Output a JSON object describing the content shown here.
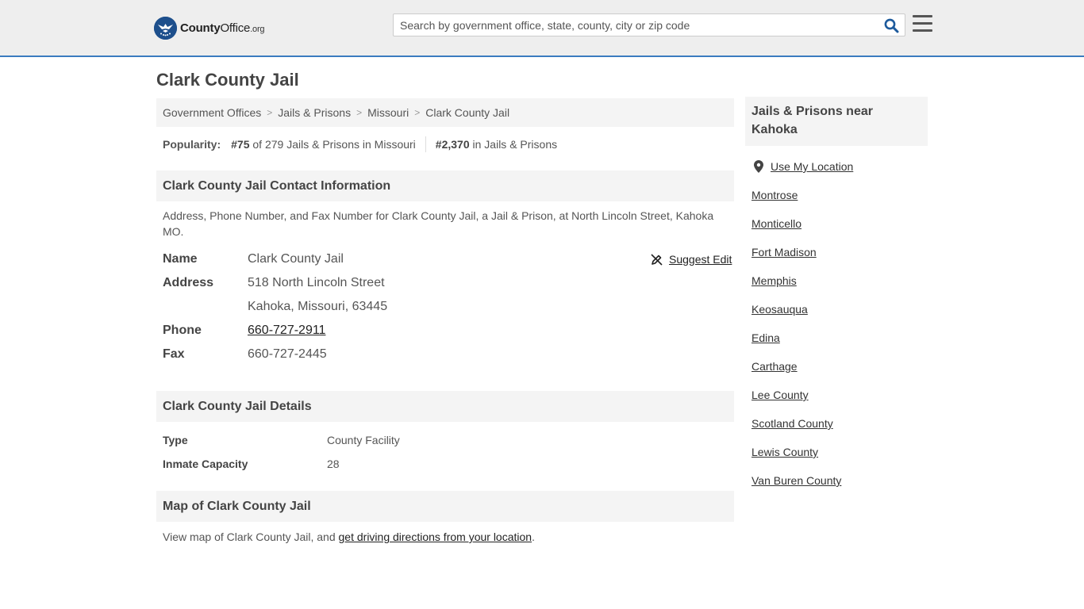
{
  "header": {
    "logo_text_bold": "County",
    "logo_text_rest": "Office",
    "logo_tld": ".org",
    "search_placeholder": "Search by government office, state, county, city or zip code"
  },
  "page": {
    "title": "Clark County Jail"
  },
  "breadcrumb": [
    "Government Offices",
    "Jails & Prisons",
    "Missouri",
    "Clark County Jail"
  ],
  "popularity": {
    "label": "Popularity:",
    "state_rank": "#75",
    "state_rank_text": "of 279 Jails & Prisons in Missouri",
    "national_rank": "#2,370",
    "national_rank_text": "in Jails & Prisons"
  },
  "contact": {
    "heading": "Clark County Jail Contact Information",
    "description": "Address, Phone Number, and Fax Number for Clark County Jail, a Jail & Prison, at North Lincoln Street, Kahoka MO.",
    "suggest_edit": "Suggest Edit",
    "name_label": "Name",
    "name_value": "Clark County Jail",
    "address_label": "Address",
    "address_line1": "518 North Lincoln Street",
    "address_line2": "Kahoka, Missouri, 63445",
    "phone_label": "Phone",
    "phone_value": "660-727-2911",
    "fax_label": "Fax",
    "fax_value": "660-727-2445"
  },
  "details": {
    "heading": "Clark County Jail Details",
    "type_label": "Type",
    "type_value": "County Facility",
    "capacity_label": "Inmate Capacity",
    "capacity_value": "28"
  },
  "map": {
    "heading": "Map of Clark County Jail",
    "text_prefix": "View map of Clark County Jail, and ",
    "link_text": "get driving directions from your location",
    "text_suffix": "."
  },
  "sidebar": {
    "heading_line1": "Jails & Prisons near",
    "heading_line2": "Kahoka",
    "use_location": "Use My Location",
    "links": [
      "Montrose",
      "Monticello",
      "Fort Madison",
      "Memphis",
      "Keosauqua",
      "Edina",
      "Carthage",
      "Lee County",
      "Scotland County",
      "Lewis County",
      "Van Buren County"
    ]
  },
  "colors": {
    "header_bg": "#eeeeee",
    "header_border": "#3a7bbf",
    "logo_blue": "#1d4f8c",
    "search_icon": "#1d5a9c",
    "section_bg": "#f4f4f4"
  }
}
